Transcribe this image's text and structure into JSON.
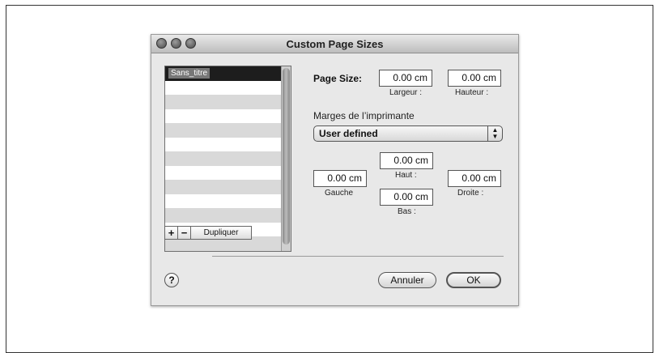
{
  "window": {
    "title": "Custom Page Sizes"
  },
  "list": {
    "items": [
      "Sans_titre",
      "",
      "",
      "",
      "",
      "",
      "",
      "",
      "",
      "",
      "",
      "",
      ""
    ],
    "selected": "Sans_titre"
  },
  "list_buttons": {
    "add": "+",
    "remove": "−",
    "duplicate": "Dupliquer"
  },
  "page_size": {
    "label": "Page Size:",
    "width_value": "0.00 cm",
    "width_label": "Largeur :",
    "height_value": "0.00 cm",
    "height_label": "Hauteur :"
  },
  "margins": {
    "section_label": "Marges de l’imprimante",
    "preset": "User defined",
    "top_value": "0.00 cm",
    "top_label": "Haut :",
    "left_value": "0.00 cm",
    "left_label": "Gauche",
    "bottom_value": "0.00 cm",
    "bottom_label": "Bas :",
    "right_value": "0.00 cm",
    "right_label": "Droite :"
  },
  "footer": {
    "help": "?",
    "cancel": "Annuler",
    "ok": "OK"
  }
}
